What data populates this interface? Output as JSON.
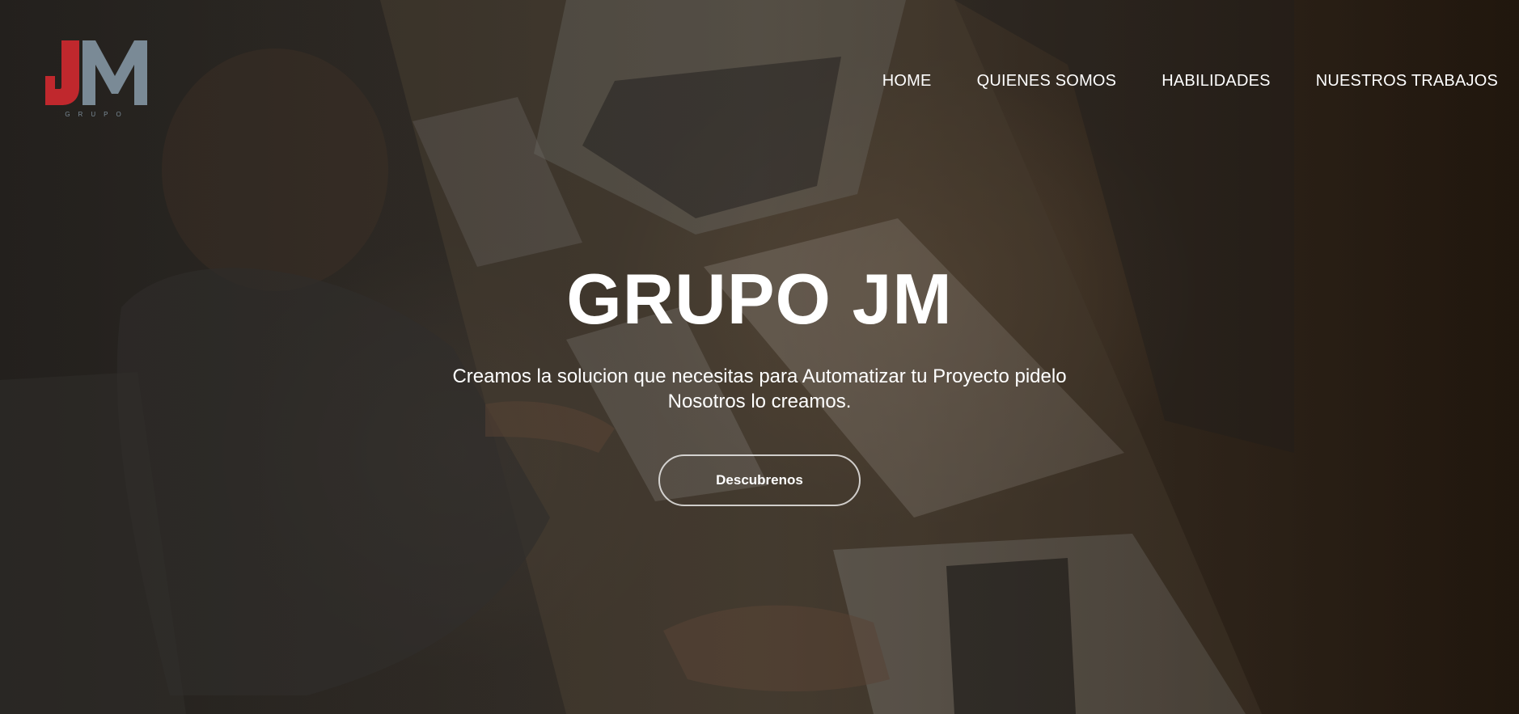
{
  "brand": {
    "logo_letters": "JM",
    "logo_caption": "GRUPO",
    "logo_red": "#c0282d",
    "logo_gray": "#7a8a96"
  },
  "nav": {
    "items": [
      {
        "label": "HOME"
      },
      {
        "label": "QUIENES SOMOS"
      },
      {
        "label": "HABILIDADES"
      },
      {
        "label": "NUESTROS TRABAJOS"
      }
    ]
  },
  "hero": {
    "title": "GRUPO JM",
    "subtitle": "Creamos la solucion que necesitas para Automatizar tu Proyecto pidelo Nosotros lo creamos.",
    "cta_label": "Descubrenos"
  }
}
